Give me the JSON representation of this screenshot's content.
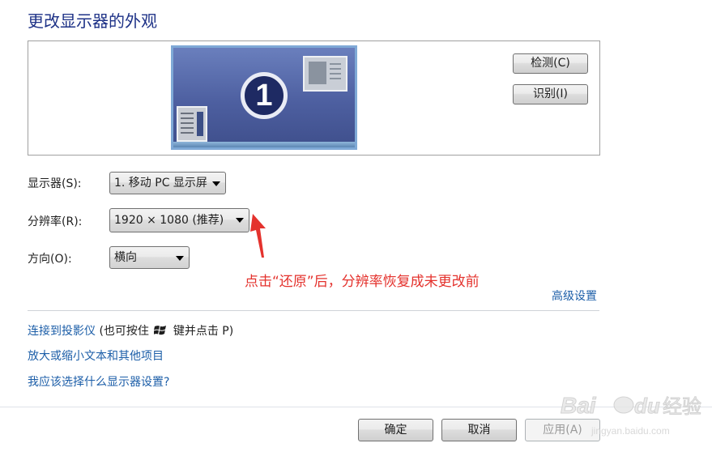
{
  "title": "更改显示器的外观",
  "preview": {
    "monitor_number": "1",
    "detect_button": "检测(C)",
    "identify_button": "识别(I)"
  },
  "settings": {
    "display_label": "显示器(S):",
    "display_value": "1. 移动 PC 显示屏",
    "resolution_label": "分辨率(R):",
    "resolution_value": "1920 × 1080 (推荐)",
    "orientation_label": "方向(O):",
    "orientation_value": "横向"
  },
  "annotation": {
    "text": "点击“还原”后，分辨率恢复成未更改前",
    "color": "#e4322d"
  },
  "links": {
    "advanced": "高级设置",
    "projector": "连接到投影仪",
    "projector_hint_before": "(也可按住",
    "projector_hint_after": "键并点击 P)",
    "zoom": "放大或缩小文本和其他项目",
    "help": "我应该选择什么显示器设置?"
  },
  "buttons": {
    "ok": "确定",
    "cancel": "取消",
    "apply": "应用(A)"
  },
  "watermark": {
    "brand": "Baidu经验",
    "url": "jingyan.baidu.com"
  },
  "colors": {
    "title": "#1e3287",
    "link": "#1c5ea8",
    "annotation": "#e4322d"
  }
}
